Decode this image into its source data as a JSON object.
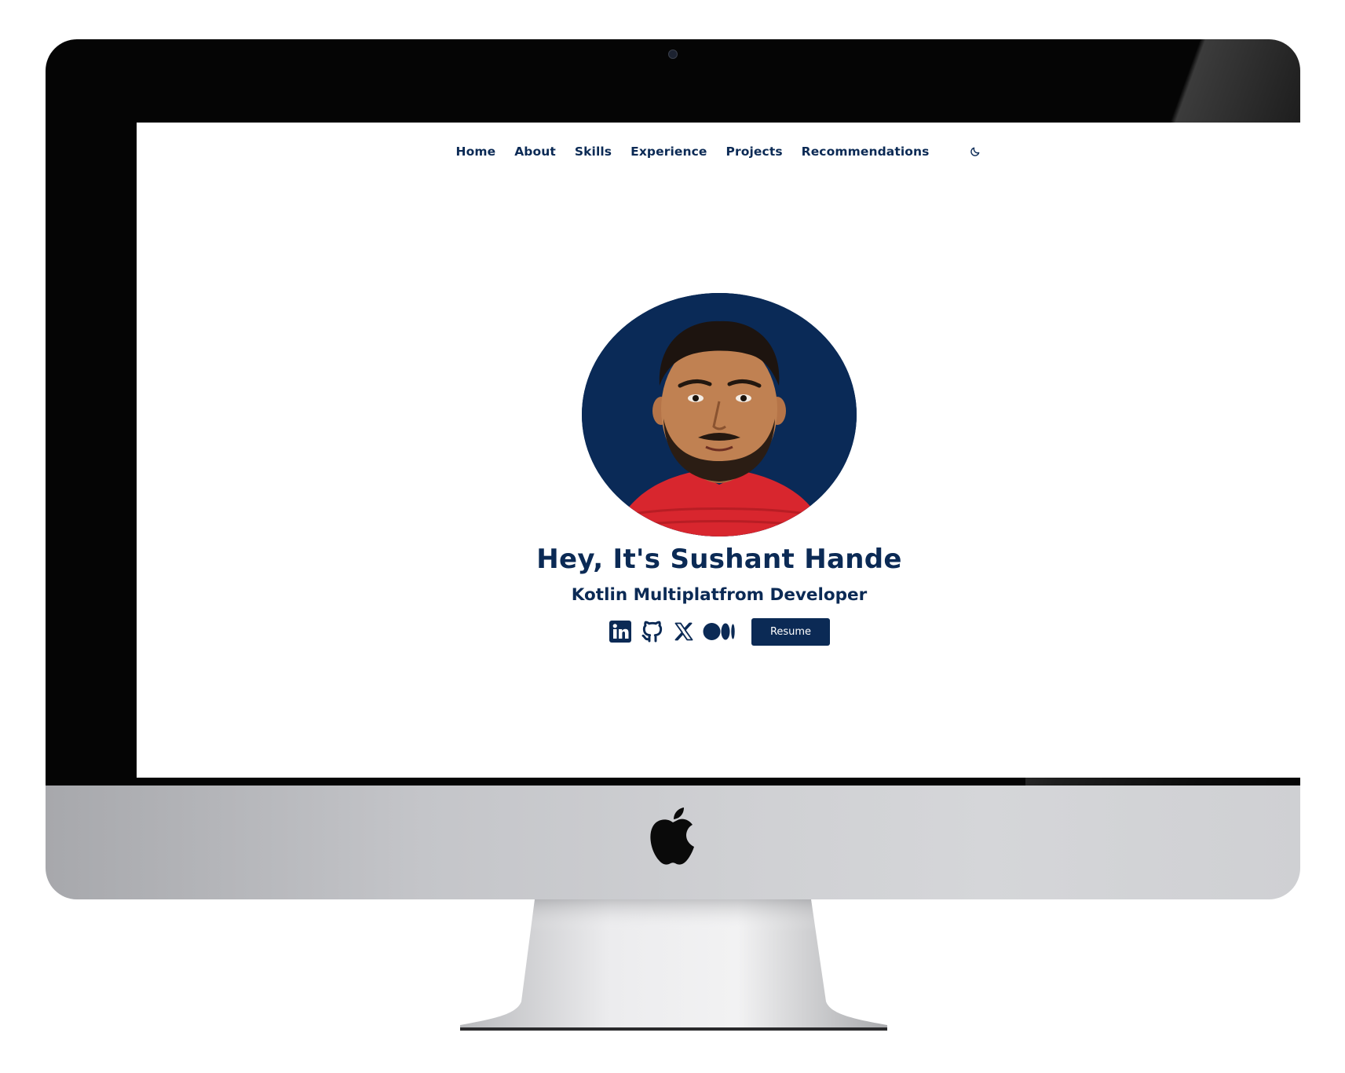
{
  "nav": {
    "items": [
      {
        "label": "Home"
      },
      {
        "label": "About"
      },
      {
        "label": "Skills"
      },
      {
        "label": "Experience"
      },
      {
        "label": "Projects"
      },
      {
        "label": "Recommendations"
      }
    ],
    "theme_toggle_icon": "moon-icon"
  },
  "hero": {
    "title": "Hey, It's Sushant Hande",
    "subtitle": "Kotlin Multiplatfrom Developer",
    "social_icons": [
      "linkedin-icon",
      "github-icon",
      "x-icon",
      "medium-icon"
    ],
    "resume_label": "Resume"
  },
  "colors": {
    "brand_navy": "#0b2a55",
    "page_bg": "#ffffff",
    "shirt_red": "#d8262e"
  }
}
